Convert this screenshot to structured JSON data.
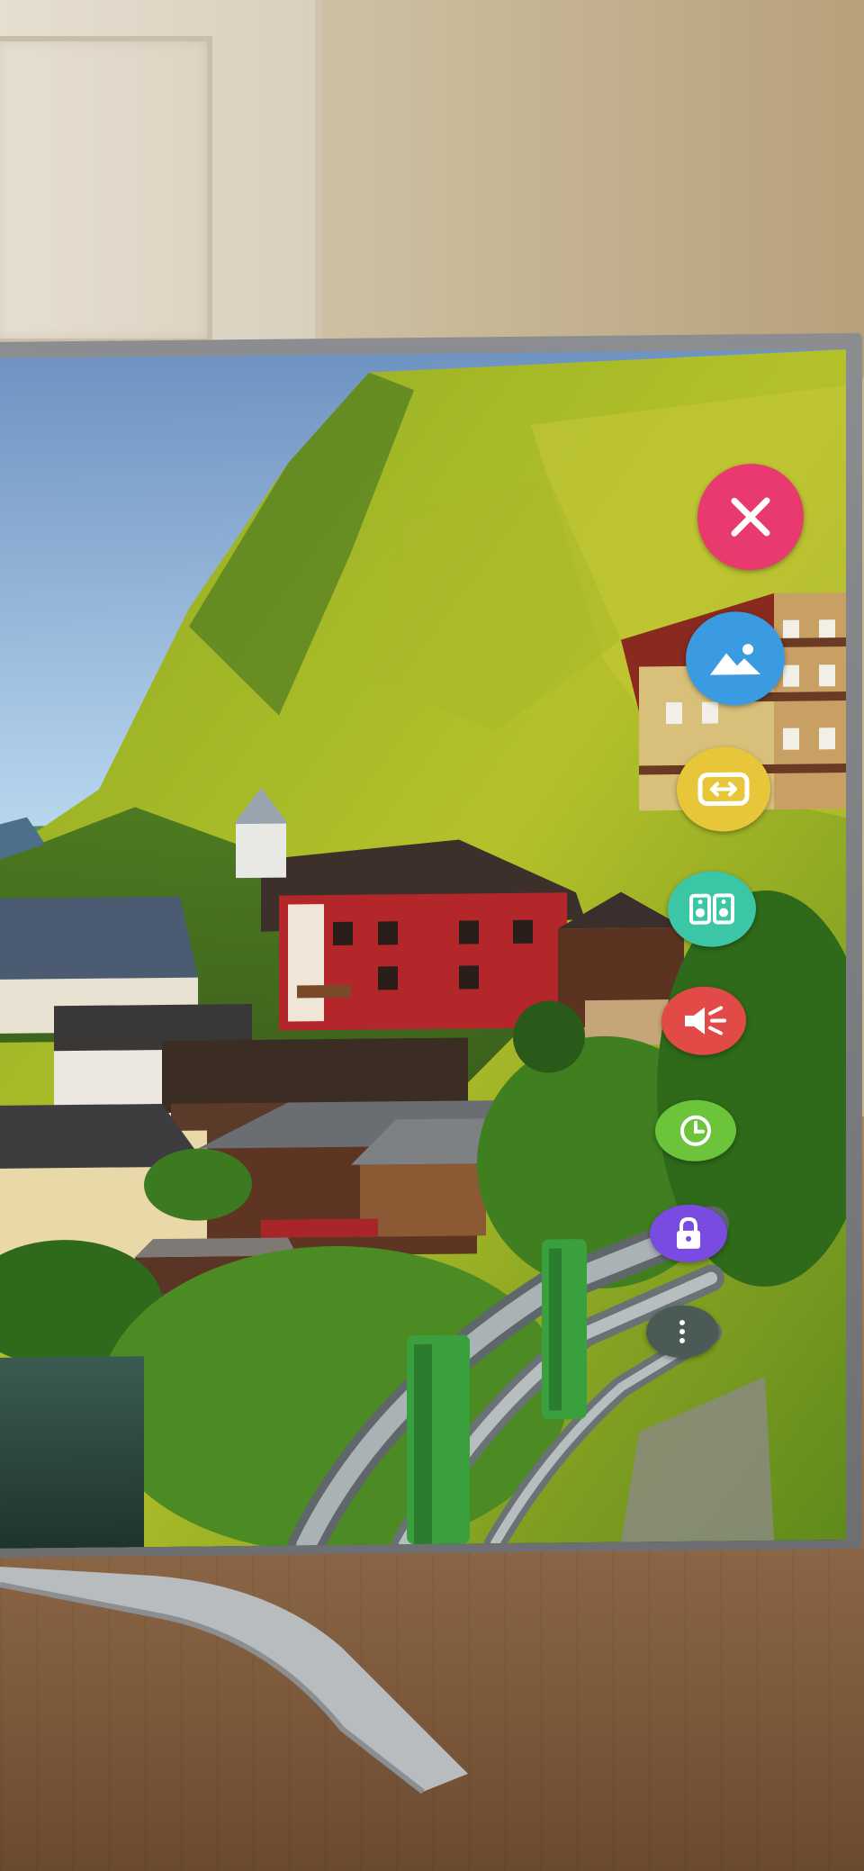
{
  "tv_menu": {
    "items": [
      {
        "name": "close",
        "icon": "close-icon",
        "color": "#e83a6e"
      },
      {
        "name": "picture",
        "icon": "picture-icon",
        "color": "#3a9be0"
      },
      {
        "name": "aspect-ratio",
        "icon": "aspect-ratio-icon",
        "color": "#e8c63a"
      },
      {
        "name": "sound-mode",
        "icon": "speakers-icon",
        "color": "#3bc7a6"
      },
      {
        "name": "sound-output",
        "icon": "speaker-output-icon",
        "color": "#e14a47"
      },
      {
        "name": "timer",
        "icon": "timer-icon",
        "color": "#6cc43a"
      },
      {
        "name": "lock",
        "icon": "lock-icon",
        "color": "#7a4be0"
      },
      {
        "name": "more",
        "icon": "more-icon",
        "color": "#4a5a56"
      }
    ]
  },
  "scene": {
    "description_colors": {
      "sky": "#9cc0e3",
      "forest": "#6a8c1e",
      "roof": "#4a3a34",
      "house_red": "#b6262a",
      "railing": "#7f8a8c"
    }
  }
}
